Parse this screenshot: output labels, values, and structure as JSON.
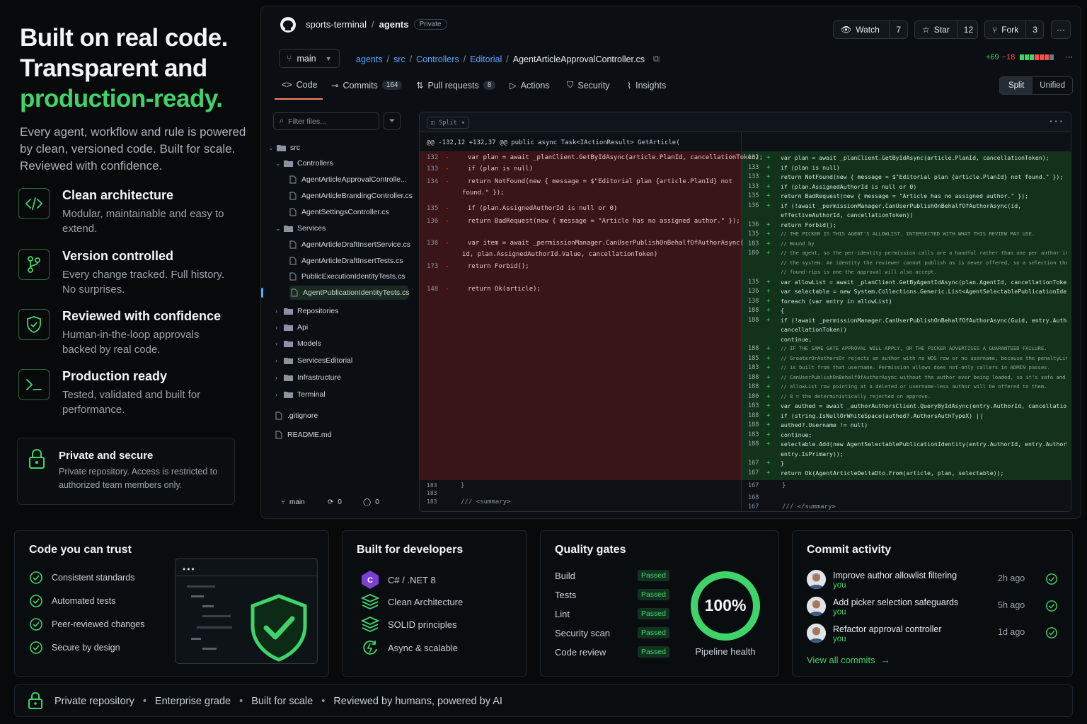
{
  "hero": {
    "line1": "Built on real code.",
    "line2": "Transparent and",
    "line3": "production-ready.",
    "description": "Every agent, workflow and rule is powered by clean, versioned code. Built for scale. Reviewed with confidence."
  },
  "features": [
    {
      "icon": "code-icon",
      "title": "Clean architecture",
      "desc": "Modular, maintainable and easy to extend."
    },
    {
      "icon": "branch-icon",
      "title": "Version controlled",
      "desc": "Every change tracked. Full history. No surprises."
    },
    {
      "icon": "shield-check-icon",
      "title": "Reviewed with confidence",
      "desc": "Human-in-the-loop approvals backed by real code."
    },
    {
      "icon": "terminal-icon",
      "title": "Production ready",
      "desc": "Tested, validated and built for performance."
    }
  ],
  "secure_box": {
    "title": "Private and secure",
    "desc": "Private repository. Access is restricted to authorized team members only."
  },
  "repo": {
    "owner": "sports-terminal",
    "name": "agents",
    "visibility": "Private",
    "watch_label": "Watch",
    "watch_count": "7",
    "star_label": "Star",
    "star_count": "12",
    "fork_label": "Fork",
    "fork_count": "3",
    "branch": "main",
    "path": [
      "agents",
      "src",
      "Controllers",
      "Editorial"
    ],
    "file": "AgentArticleApprovalController.cs",
    "additions": "+69",
    "deletions": "−18"
  },
  "tabs": [
    {
      "label": "Code",
      "icon": "code-icon"
    },
    {
      "label": "Commits",
      "count": "164",
      "icon": "commit-icon"
    },
    {
      "label": "Pull requests",
      "count": "8",
      "icon": "pull-request-icon"
    },
    {
      "label": "Actions",
      "icon": "play-icon"
    },
    {
      "label": "Security",
      "icon": "shield-icon"
    },
    {
      "label": "Insights",
      "icon": "graph-icon"
    }
  ],
  "view_toggle": {
    "split": "Split",
    "unified": "Unified"
  },
  "filter_placeholder": "Filter files...",
  "tree": [
    {
      "label": "src",
      "type": "folder",
      "depth": 0,
      "open": true
    },
    {
      "label": "Controllers",
      "type": "folder",
      "depth": 1,
      "open": true
    },
    {
      "label": "AgentArticleApprovalControlle...",
      "type": "file",
      "depth": 2
    },
    {
      "label": "AgentArticleBrandingController.cs",
      "type": "file",
      "depth": 2
    },
    {
      "label": "AgentSettingsController.cs",
      "type": "file",
      "depth": 2
    },
    {
      "label": "Services",
      "type": "folder",
      "depth": 1,
      "open": true
    },
    {
      "label": "AgentArticleDraftInsertService.cs",
      "type": "file",
      "depth": 2
    },
    {
      "label": "AgentArticleDraftInsertTests.cs",
      "type": "file",
      "depth": 2
    },
    {
      "label": "PublicExecutionIdentityTests.cs",
      "type": "file",
      "depth": 2
    },
    {
      "label": "AgentPublicationIdentityTests.cs",
      "type": "file",
      "depth": 2,
      "selected": true
    },
    {
      "label": "Repositories",
      "type": "folder",
      "depth": 1
    },
    {
      "label": "Api",
      "type": "folder",
      "depth": 1
    },
    {
      "label": "Models",
      "type": "folder",
      "depth": 1
    },
    {
      "label": "ServicesEditorial",
      "type": "folder",
      "depth": 1
    },
    {
      "label": "Infrastructure",
      "type": "folder",
      "depth": 1
    },
    {
      "label": "Terminal",
      "type": "folder",
      "depth": 1
    },
    {
      "label": ".gitignore",
      "type": "file",
      "depth": 0
    },
    {
      "label": "README.md",
      "type": "file",
      "depth": 0
    }
  ],
  "tree_footer": {
    "branch": "main",
    "a": "0",
    "b": "0"
  },
  "diff": {
    "mode": "Split",
    "hunk": "@@ -132,12 +132,37 @@ public async Task<IActionResult> GetArticle(",
    "left": [
      {
        "n": "132",
        "s": "-",
        "t": "var plan = await _planClient.GetByIdAsync(article.PlanId, cancellationToken);"
      },
      {
        "n": "133",
        "s": "-",
        "t": "if (plan is null)"
      },
      {
        "n": "134",
        "s": "-",
        "t": "    return NotFound(new { message = $\"Editorial plan {article.PlanId} not"
      },
      {
        "n": "",
        "s": "",
        "t": "found.\" });"
      },
      {
        "n": "135",
        "s": "-",
        "t": "if (plan.AssignedAuthorId is null or 0)"
      },
      {
        "n": "136",
        "s": "-",
        "t": "    return BadRequest(new { message = \"Article has no assigned author.\" });"
      },
      {
        "n": "138",
        "s": "-",
        "t": "var item = await _permissionManager.CanUserPublishOnBehalfOfAuthorAsync("
      },
      {
        "n": "",
        "s": "",
        "t": "id, plan.AssignedAuthorId.Value, cancellationToken)"
      },
      {
        "n": "173",
        "s": "-",
        "t": "return Forbid();"
      },
      {
        "n": "148",
        "s": "-",
        "t": "return Ok(article);"
      }
    ],
    "left_tail": [
      {
        "n": "183",
        "t": "}"
      },
      {
        "n": "183",
        "t": ""
      },
      {
        "n": "183",
        "t": "/// <summary>"
      }
    ],
    "right": [
      {
        "n": "132",
        "t": "var plan = await _planClient.GetByIdAsync(article.PlanId, cancellationToken);"
      },
      {
        "n": "133",
        "t": "if (plan is null)"
      },
      {
        "n": "133",
        "t": "    return NotFound(new { message = $\"Editorial plan {article.PlanId} not found.\" });"
      },
      {
        "n": "133",
        "t": "if (plan.AssignedAuthorId is null or 0)"
      },
      {
        "n": "135",
        "t": "    return BadRequest(new { message = \"Article has no assigned author.\" });"
      },
      {
        "n": "136",
        "t": "if (!await _permissionManager.CanUserPublishOnBehalfOfAuthorAsync(id,"
      },
      {
        "n": "",
        "t": "effectiveAuthorId, cancellationToken))"
      },
      {
        "n": "136",
        "t": "    return Forbid();"
      },
      {
        "n": "135",
        "t": "// THE PICKER IS THIS AGENT'S ALLOWLIST, INTERSECTED WITH WHAT THIS REVIEW MAY USE."
      },
      {
        "n": "183",
        "t": "// Bound by"
      },
      {
        "n": "180",
        "t": "// the agent, so the per-identity permission calls are a handful rather than one per author in"
      },
      {
        "n": "",
        "t": "// the system. An identity the reviewer cannot publish as is never offered, so a selection that"
      },
      {
        "n": "",
        "t": "// found-rips is one the approval will also accept."
      },
      {
        "n": "135",
        "t": "var allowList = await _planClient.GetByAgentIdAsync(plan.AgentId, cancellationToken);"
      },
      {
        "n": "136",
        "t": "var selectable = new System.Collections.Generic.List<AgentSelectablePublicationIdentity>(allowList.Count);"
      },
      {
        "n": "138",
        "t": "foreach (var entry in allowList)"
      },
      {
        "n": "188",
        "t": "{"
      },
      {
        "n": "188",
        "t": "    if (!await _permissionManager.CanUserPublishOnBehalfOfAuthorAsync(Guid, entry.AuthorId,"
      },
      {
        "n": "",
        "t": "cancellationToken))"
      },
      {
        "n": "",
        "t": "        continue;"
      },
      {
        "n": "188",
        "t": "    // IF THE SAME GATE APPROVAL WILL APPLY, OR THE PICKER ADVERTISES A GUARANTEED FAILURE."
      },
      {
        "n": "185",
        "t": "    // GreaterOrAuthorsOr rejects an author with no WOS row or no username, because the penaltyLink"
      },
      {
        "n": "183",
        "t": "    // is built from that username. Permission allows does not-only callers in ADMIN passes."
      },
      {
        "n": "188",
        "t": "    // CanUserPublishOnBehalfOfAuthorAsync without the author ever being loaded, so it's safe and"
      },
      {
        "n": "188",
        "t": "    // allowList row pointing at a deleted or username-less author will be offered to them."
      },
      {
        "n": "180",
        "t": "    // 8 = the deterministically rejected on approve."
      },
      {
        "n": "183",
        "t": "    var authed = await _authorAuthorsClient.QueryByIdAsync(entry.AuthorId, cancellationToken);"
      },
      {
        "n": "188",
        "t": "    if (string.IsNullOrWhiteSpace(authed?.AuthorsAuthTypeX) ||"
      },
      {
        "n": "188",
        "t": "        authed?.Username != null)"
      },
      {
        "n": "183",
        "t": "        continue;"
      },
      {
        "n": "188",
        "t": "    selectable.Add(new AgentSelectablePublicationIdentity(entry.AuthorId, entry.AuthorName,"
      },
      {
        "n": "",
        "t": "entry.IsPrimary));"
      },
      {
        "n": "167",
        "t": "}"
      },
      {
        "n": "167",
        "t": "return Ok(AgentArticleDeltaDto.From(article, plan, selectable));"
      }
    ],
    "right_tail": [
      {
        "n": "167",
        "t": "}"
      },
      {
        "n": "168",
        "t": ""
      },
      {
        "n": "167",
        "t": "/// </summary>"
      }
    ]
  },
  "trust": {
    "title": "Code you can trust",
    "items": [
      "Consistent standards",
      "Automated tests",
      "Peer-reviewed changes",
      "Secure by design"
    ]
  },
  "devs": {
    "title": "Built for developers",
    "items": [
      {
        "label": "C# / .NET 8",
        "icon": "csharp-icon"
      },
      {
        "label": "Clean Architecture",
        "icon": "layers-icon"
      },
      {
        "label": "SOLID principles",
        "icon": "stack-icon"
      },
      {
        "label": "Async & scalable",
        "icon": "async-icon"
      }
    ]
  },
  "quality": {
    "title": "Quality gates",
    "gates": [
      {
        "label": "Build",
        "status": "Passed"
      },
      {
        "label": "Tests",
        "status": "Passed"
      },
      {
        "label": "Lint",
        "status": "Passed"
      },
      {
        "label": "Security scan",
        "status": "Passed"
      },
      {
        "label": "Code review",
        "status": "Passed"
      }
    ],
    "health_value": "100%",
    "health_fraction": 1.0,
    "health_label": "Pipeline health"
  },
  "commits": {
    "title": "Commit activity",
    "items": [
      {
        "msg": "Improve author allowlist filtering",
        "who": "you",
        "when": "2h ago"
      },
      {
        "msg": "Add picker selection safeguards",
        "who": "you",
        "when": "5h ago"
      },
      {
        "msg": "Refactor approval controller",
        "who": "you",
        "when": "1d ago"
      }
    ],
    "view_all": "View all commits"
  },
  "footer": [
    "Private repository",
    "Enterprise grade",
    "Built for scale",
    "Reviewed by humans, powered by AI"
  ],
  "colors": {
    "accent": "#3fd46a",
    "link": "#58a6ff",
    "deletion": "#f85149",
    "addition_bg": "#12321c",
    "deletion_bg": "#3a1518"
  }
}
